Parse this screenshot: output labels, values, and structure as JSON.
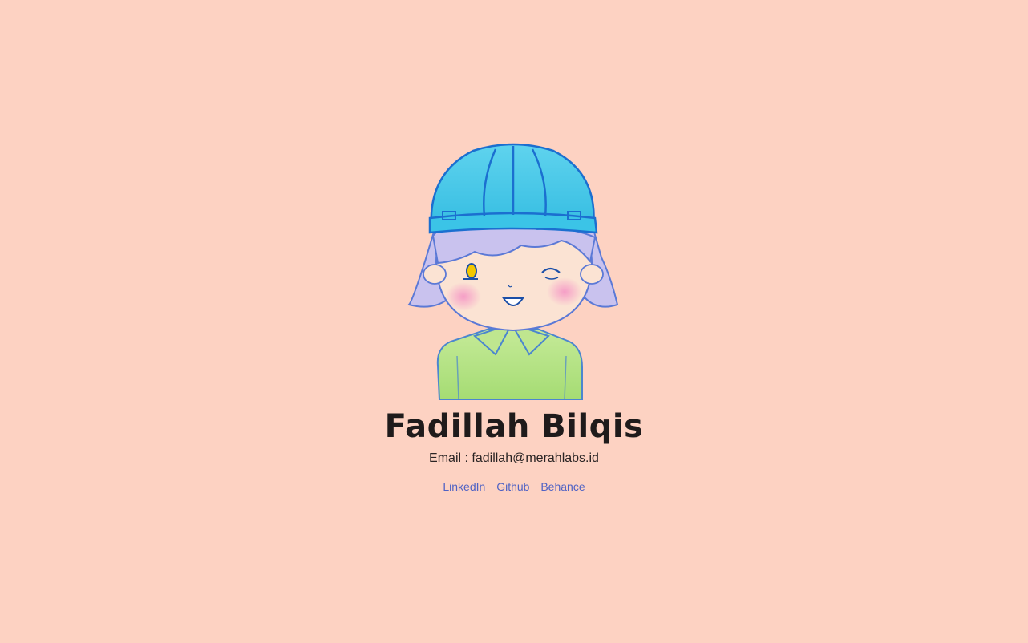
{
  "profile": {
    "name": "Fadillah Bilqis",
    "email_label": "Email : ",
    "email": "fadillah@merahlabs.id",
    "links": [
      {
        "label": "LinkedIn"
      },
      {
        "label": "Github"
      },
      {
        "label": "Behance"
      }
    ]
  },
  "colors": {
    "background": "#fdd2c2",
    "link": "#4f62c4",
    "text": "#1f1b1b",
    "helmet": "#3fc5e6",
    "hair": "#c9c2ee",
    "shirt": "#b8e68a"
  },
  "avatar": {
    "icon": "cartoon-girl-with-blue-helmet-illustration"
  }
}
